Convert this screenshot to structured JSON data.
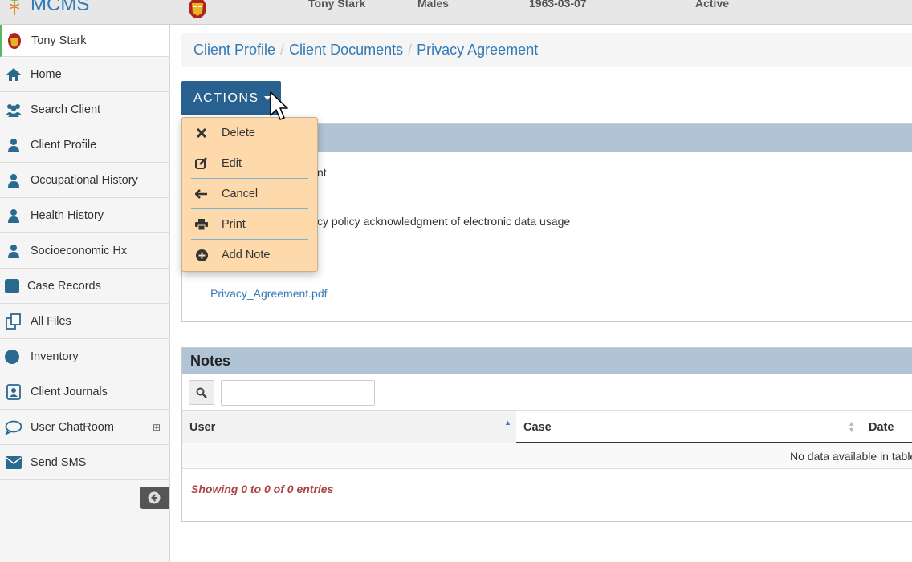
{
  "topbar": {
    "brand": "MCMS",
    "client_name": "Tony Stark",
    "gender": "Males",
    "dob": "1963-03-07",
    "status": "Active"
  },
  "sidebar": {
    "items": [
      {
        "label": "Tony Stark",
        "icon": "avatar"
      },
      {
        "label": "Home",
        "icon": "home-icon"
      },
      {
        "label": "Search Client",
        "icon": "users-icon"
      },
      {
        "label": "Client Profile",
        "icon": "user-icon"
      },
      {
        "label": "Occupational History",
        "icon": "user-icon"
      },
      {
        "label": "Health History",
        "icon": "user-icon"
      },
      {
        "label": "Socioeconomic Hx",
        "icon": "user-icon"
      },
      {
        "label": "Case Records",
        "icon": "square-icon"
      },
      {
        "label": "All Files",
        "icon": "files-icon"
      },
      {
        "label": "Inventory",
        "icon": "circle-icon"
      },
      {
        "label": "Client Journals",
        "icon": "contact-icon"
      },
      {
        "label": "User ChatRoom",
        "icon": "chat-icon",
        "expand": "⊞"
      },
      {
        "label": "Send SMS",
        "icon": "envelope-icon"
      }
    ]
  },
  "breadcrumb": [
    "Client Profile",
    "Client Documents",
    "Privacy Agreement"
  ],
  "actions": {
    "label": "ACTIONS",
    "menu": [
      {
        "label": "Delete",
        "icon": "times-icon"
      },
      {
        "label": "Edit",
        "icon": "edit-icon"
      },
      {
        "label": "Cancel",
        "icon": "arrow-left-icon"
      },
      {
        "label": "Print",
        "icon": "print-icon"
      },
      {
        "label": "Add Note",
        "icon": "plus-circle-icon"
      }
    ]
  },
  "document": {
    "line1_fragment": "nt",
    "line2_fragment": "cy policy acknowledgment of electronic data usage",
    "attachment_link": "Privacy_Agreement.pdf"
  },
  "notes": {
    "title": "Notes",
    "search_value": "",
    "columns": [
      "User",
      "Case",
      "Date"
    ],
    "empty_message": "No data available in table",
    "showing": "Showing 0 to 0 of 0 entries"
  },
  "colors": {
    "primary": "#286090",
    "link": "#337ab7",
    "panel_header": "#b0c4d5",
    "dropdown_bg": "#fdd9ab",
    "sidebar_icon": "#2b6a8f"
  }
}
